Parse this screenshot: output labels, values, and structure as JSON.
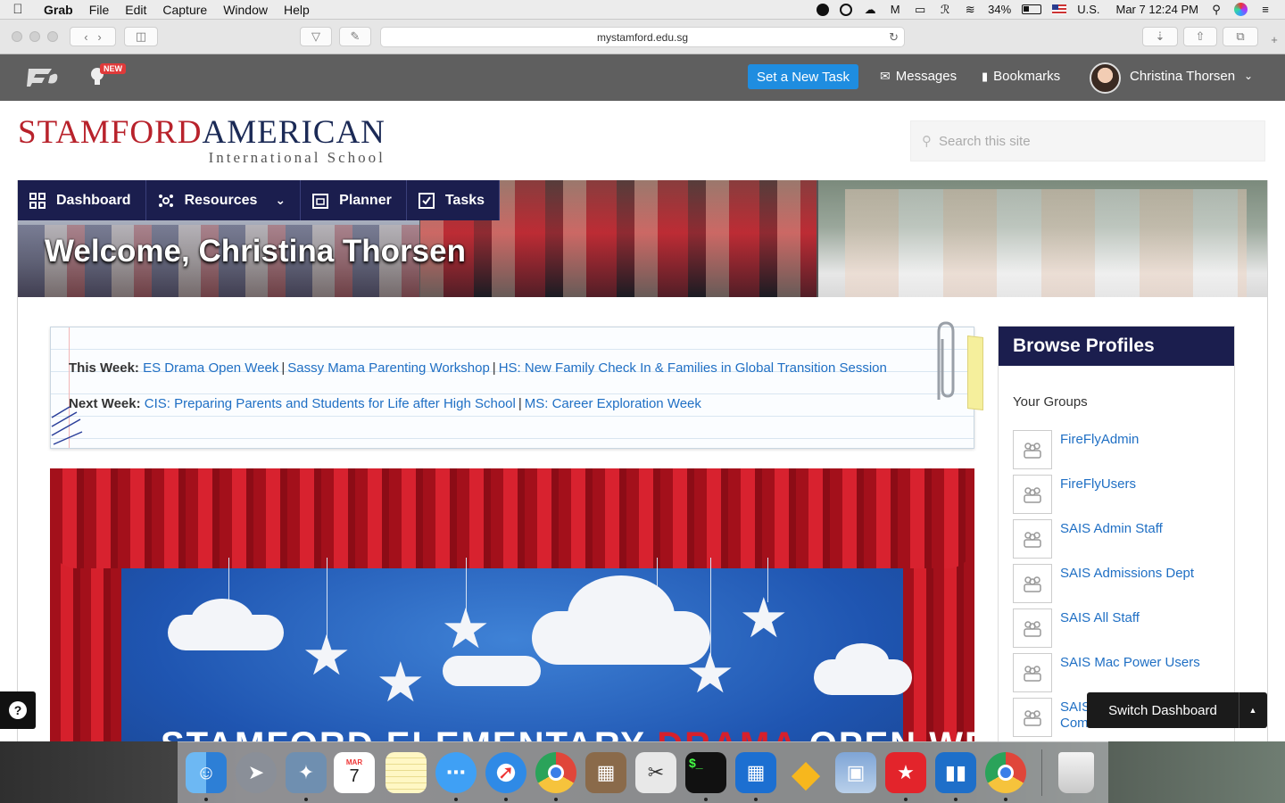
{
  "menubar": {
    "app": "Grab",
    "items": [
      "File",
      "Edit",
      "Capture",
      "Window",
      "Help"
    ],
    "battery": "34%",
    "input_source": "U.S.",
    "datetime": "Mar 7  12:24 PM"
  },
  "browser": {
    "url": "mystamford.edu.sg"
  },
  "site_header": {
    "new_badge": "NEW",
    "set_task": "Set a New Task",
    "messages": "Messages",
    "bookmarks": "Bookmarks",
    "user_name": "Christina Thorsen"
  },
  "brand": {
    "part1": "STAMFORD",
    "part2": "AMERICAN",
    "subtitle": "International School",
    "colors": {
      "red": "#b8222b",
      "navy": "#1b2a56"
    }
  },
  "search": {
    "placeholder": "Search this site"
  },
  "nav": {
    "items": [
      {
        "label": "Dashboard",
        "icon": "grid-icon"
      },
      {
        "label": "Resources",
        "icon": "network-icon"
      },
      {
        "label": "Planner",
        "icon": "calendar-icon"
      },
      {
        "label": "Tasks",
        "icon": "checkbox-icon"
      }
    ]
  },
  "welcome": "Welcome, Christina Thorsen",
  "notice": {
    "this_week_label": "This Week:",
    "this_week": [
      "ES Drama Open Week",
      "Sassy Mama Parenting Workshop",
      "HS: New Family Check In & Families in Global Transition Session"
    ],
    "next_week_label": "Next Week:",
    "next_week": [
      "CIS: Preparing Parents and Students for Life after High School",
      "MS: Career Exploration Week"
    ]
  },
  "stage": {
    "title_part1": "STAMFORD ELEMENTARY ",
    "title_part2": "DRAMA",
    "title_part3": " OPEN WEEK"
  },
  "profiles": {
    "title": "Browse Profiles",
    "groups_label": "Your Groups",
    "groups": [
      "FireFlyAdmin",
      "FireFlyUsers",
      "SAIS Admin Staff",
      "SAIS Admissions Dept",
      "SAIS All Staff",
      "SAIS Mac Power Users",
      "SAIS Communications"
    ]
  },
  "switch_dashboard": "Switch Dashboard",
  "dock": {
    "apps": [
      "Finder",
      "Launchpad",
      "Preview",
      "Calendar",
      "Notes",
      "Messages",
      "Safari",
      "Chrome",
      "Calculator",
      "Script Editor",
      "Terminal",
      "Mosaic",
      "Sketch",
      "Image Capture",
      "Bookmark",
      "Trello",
      "Chrome",
      "Trash"
    ],
    "calendar_month": "MAR",
    "calendar_day": "7"
  }
}
